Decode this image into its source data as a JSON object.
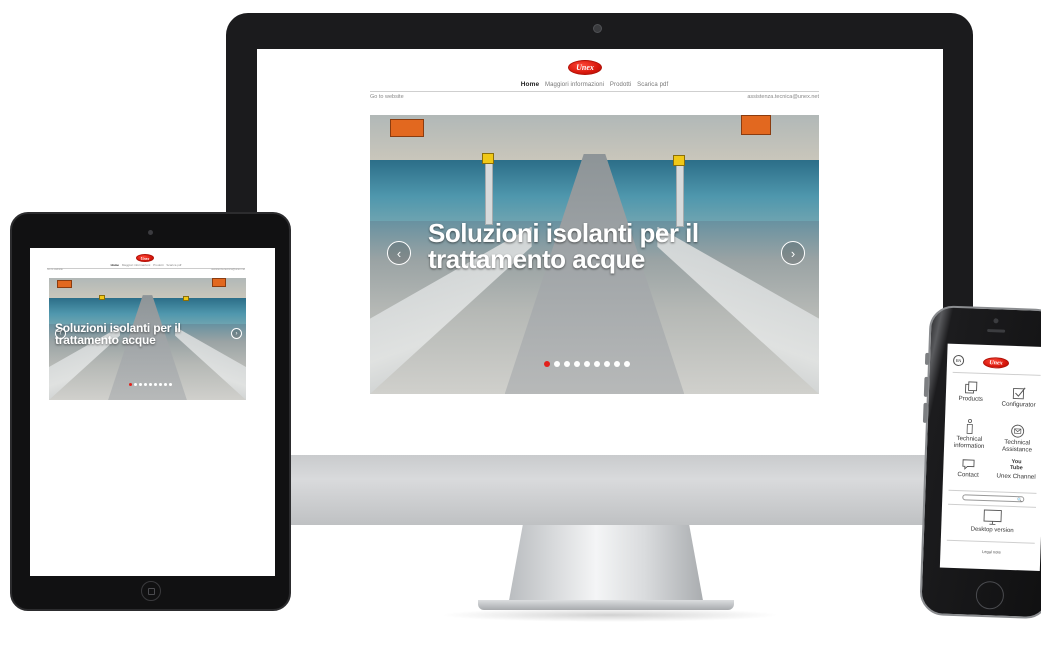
{
  "site": {
    "logo": "Unex",
    "nav": [
      "Home",
      "Maggiori informazioni",
      "Prodotti",
      "Scarica pdf"
    ],
    "go_to_website": "Go to website",
    "email": "assistenza.tecnica@unex.net",
    "hero_line1": "Soluzioni isolanti per il",
    "hero_line2": "trattamento acque",
    "arrow_prev": "‹",
    "arrow_next": "›",
    "slide_count": 9,
    "active_slide": 0
  },
  "mobile": {
    "language": "EN",
    "logo": "Unex",
    "items": [
      {
        "label": "Products",
        "icon": "products-icon"
      },
      {
        "label": "Configurator",
        "icon": "configurator-check-icon"
      },
      {
        "label": "Technical information",
        "icon": "info-icon"
      },
      {
        "label": "Technical Assistance",
        "icon": "mail-icon"
      },
      {
        "label": "Contact",
        "icon": "chat-icon"
      },
      {
        "label": "Unex Channel",
        "icon": "youtube-icon"
      }
    ],
    "youtube_line1": "You",
    "youtube_line2": "Tube",
    "search_icon": "🔍",
    "desktop_version": "Desktop version",
    "legal_note": "Legal note"
  },
  "colors": {
    "brand_red": "#d8170c",
    "dot_active": "#e2211c"
  }
}
